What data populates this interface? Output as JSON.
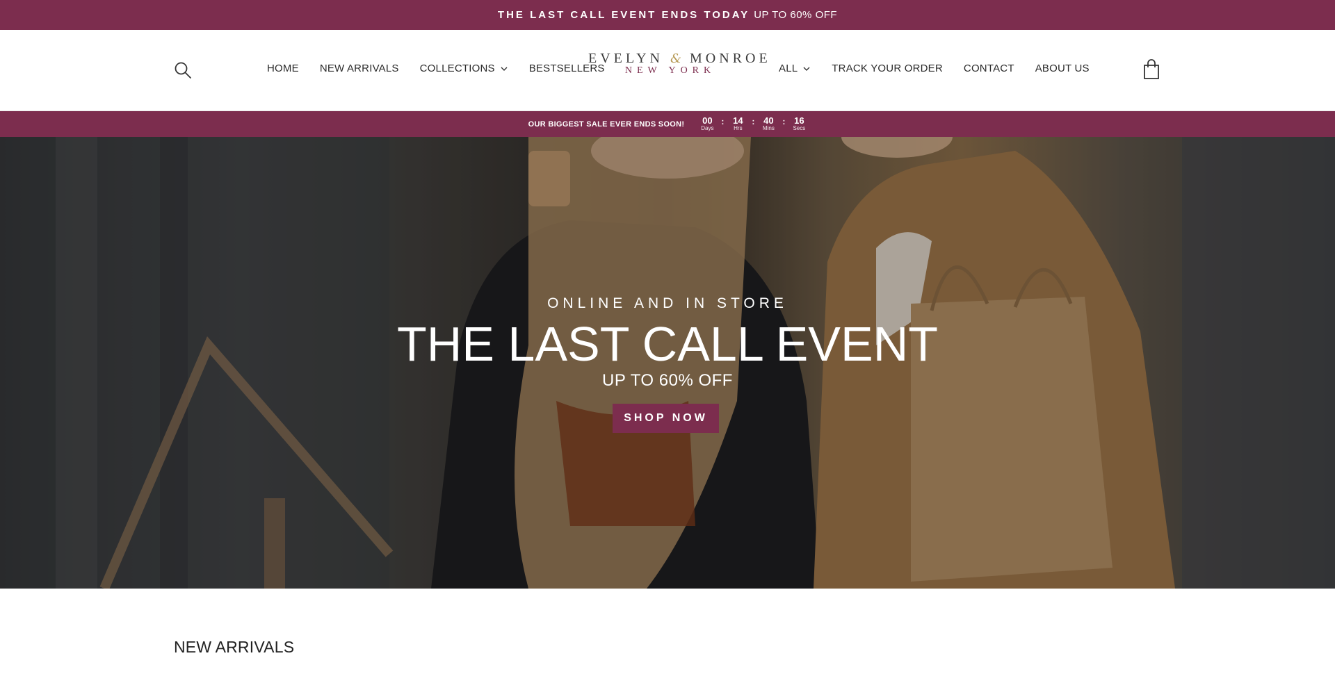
{
  "announcement": {
    "strong": "THE LAST CALL EVENT ENDS TODAY",
    "light": "UP TO 60% OFF"
  },
  "header": {
    "nav_left": [
      {
        "label": "HOME",
        "dropdown": false
      },
      {
        "label": "NEW ARRIVALS",
        "dropdown": false
      },
      {
        "label": "COLLECTIONS",
        "dropdown": true
      },
      {
        "label": "BESTSELLERS",
        "dropdown": false
      }
    ],
    "logo": {
      "main_1": "EVELYN",
      "amp": "&",
      "main_2": "MONROE",
      "sub": "NEW YORK"
    },
    "nav_right": [
      {
        "label": "ALL",
        "dropdown": true
      },
      {
        "label": "TRACK YOUR ORDER",
        "dropdown": false
      },
      {
        "label": "CONTACT",
        "dropdown": false
      },
      {
        "label": "ABOUT US",
        "dropdown": false
      }
    ],
    "icons": {
      "search": "search-icon",
      "cart": "shopping-bag-icon"
    }
  },
  "countdown": {
    "message": "OUR BIGGEST SALE EVER ENDS SOON!",
    "units": [
      {
        "value": "00",
        "label": "Days"
      },
      {
        "value": "14",
        "label": "Hrs"
      },
      {
        "value": "40",
        "label": "Mins"
      },
      {
        "value": "16",
        "label": "Secs"
      }
    ],
    "separator": ":"
  },
  "hero": {
    "eyebrow": "ONLINE AND IN STORE",
    "title": "THE LAST CALL EVENT",
    "subtitle": "UP TO 60% OFF",
    "cta": "SHOP NOW"
  },
  "sections": {
    "new_arrivals_title": "NEW ARRIVALS"
  },
  "colors": {
    "brand": "#7c2d4e",
    "gold": "#b79a56",
    "text": "#222222"
  }
}
